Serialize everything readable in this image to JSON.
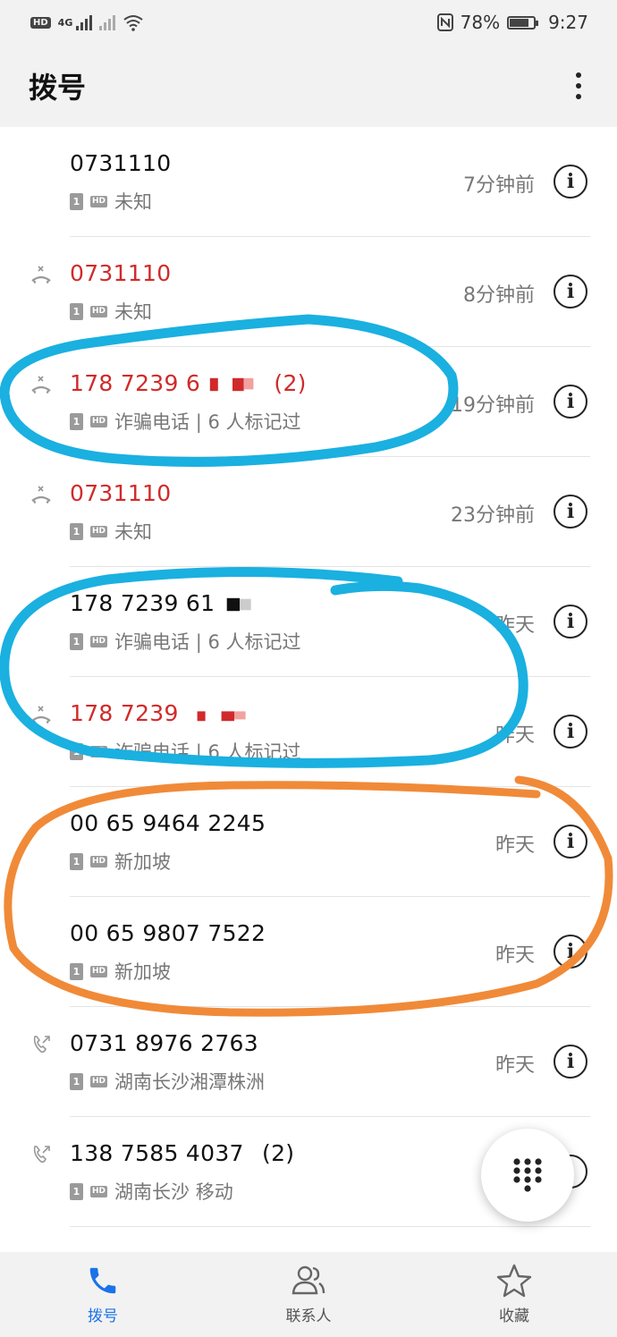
{
  "status_bar": {
    "hd": "HD",
    "network": "4G",
    "battery": "78%",
    "time": "9:27"
  },
  "header": {
    "title": "拨号"
  },
  "calls": [
    {
      "number": "0731110",
      "missed": false,
      "icon": "none",
      "location": "未知",
      "time": "7分钟前"
    },
    {
      "number": "0731110",
      "missed": true,
      "icon": "missed-call-icon",
      "location": "未知",
      "time": "8分钟前"
    },
    {
      "number": "178 7239 6",
      "suffix": "(2)",
      "missed": true,
      "icon": "missed-call-icon",
      "location": "诈骗电话 | 6 人标记过",
      "time": "19分钟前"
    },
    {
      "number": "0731110",
      "missed": true,
      "icon": "missed-call-icon",
      "location": "未知",
      "time": "23分钟前"
    },
    {
      "number": "178 7239 61",
      "missed": false,
      "icon": "none",
      "location": "诈骗电话 | 6 人标记过",
      "time": "昨天"
    },
    {
      "number": "178 7239",
      "missed": true,
      "icon": "missed-call-icon",
      "location": "诈骗电话 | 6 人标记过",
      "time": "昨天"
    },
    {
      "number": "00 65 9464 2245",
      "missed": false,
      "icon": "none",
      "location": "新加坡",
      "time": "昨天"
    },
    {
      "number": "00 65 9807 7522",
      "missed": false,
      "icon": "none",
      "location": "新加坡",
      "time": "昨天"
    },
    {
      "number": "0731 8976 2763",
      "missed": false,
      "icon": "outgoing-call-icon",
      "location": "湖南长沙湘潭株洲",
      "time": "昨天"
    },
    {
      "number": "138 7585 4037",
      "suffix": "(2)",
      "missed": false,
      "icon": "outgoing-call-icon",
      "location": "湖南长沙 移动",
      "time": ""
    }
  ],
  "bottom_nav": {
    "dial": "拨号",
    "contacts": "联系人",
    "favorites": "收藏"
  },
  "colors": {
    "missed": "#d12a2a",
    "accent": "#1a73e8",
    "annotation_blue": "#1ab0e0",
    "annotation_orange": "#f08a38"
  }
}
